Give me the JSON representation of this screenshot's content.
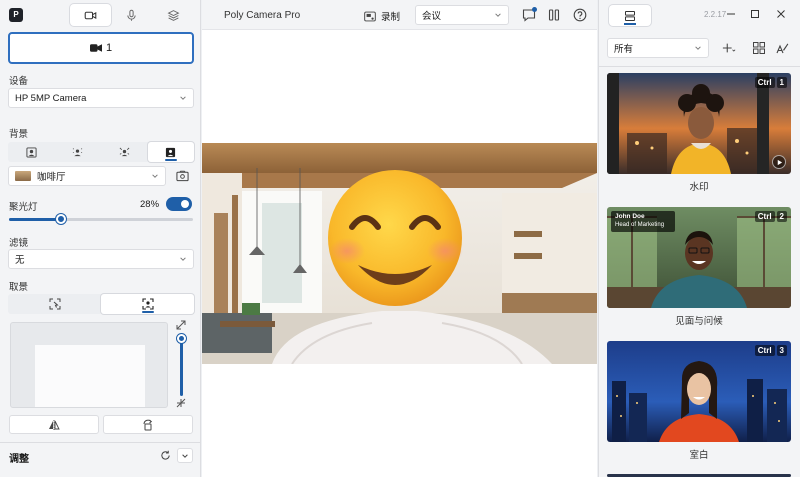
{
  "left": {
    "logo": "P",
    "cam_button_label": "1",
    "device_label": "设备",
    "device_value": "HP 5MP Camera",
    "background_label": "背景",
    "background_value": "咖啡厅",
    "spotlight_label": "聚光灯",
    "spotlight_value": 0.28,
    "spotlight_percent": "28%",
    "filter_label": "滤镜",
    "filter_value": "无",
    "framing_label": "取景",
    "adjust_label": "调整"
  },
  "center": {
    "app_title": "Poly Camera Pro",
    "record_label": "录制",
    "mode_value": "会议"
  },
  "right": {
    "version": "2.2.17",
    "filter_value": "所有",
    "cards": [
      {
        "caption": "水印",
        "hotkey": [
          "Ctrl",
          "1"
        ]
      },
      {
        "caption": "见面与问候",
        "hotkey": [
          "Ctrl",
          "2"
        ],
        "name": "John Doe",
        "subtitle": "Head of Marketing"
      },
      {
        "caption": "室白",
        "hotkey": [
          "Ctrl",
          "3"
        ]
      },
      {
        "caption": "",
        "hotkey": []
      }
    ]
  },
  "colors": {
    "accent": "#1f5fa8",
    "panel": "#f3f4f6"
  },
  "icons": [
    "app-logo-icon",
    "video-icon",
    "mic-icon",
    "layers-icon",
    "camera-icon",
    "chevron-down-icon",
    "person-icon",
    "blur-icon",
    "sparkle-icon",
    "image-icon",
    "picture-icon",
    "frame-person-icon",
    "mirror-icon",
    "rotate-icon",
    "reset-icon",
    "expand-icon",
    "shrink-icon",
    "record-icon",
    "chat-icon",
    "pause-icon",
    "help-icon",
    "list-icon",
    "minimize-icon",
    "maximize-icon",
    "close-icon",
    "add-icon",
    "grid-icon",
    "paint-icon",
    "play-icon"
  ]
}
